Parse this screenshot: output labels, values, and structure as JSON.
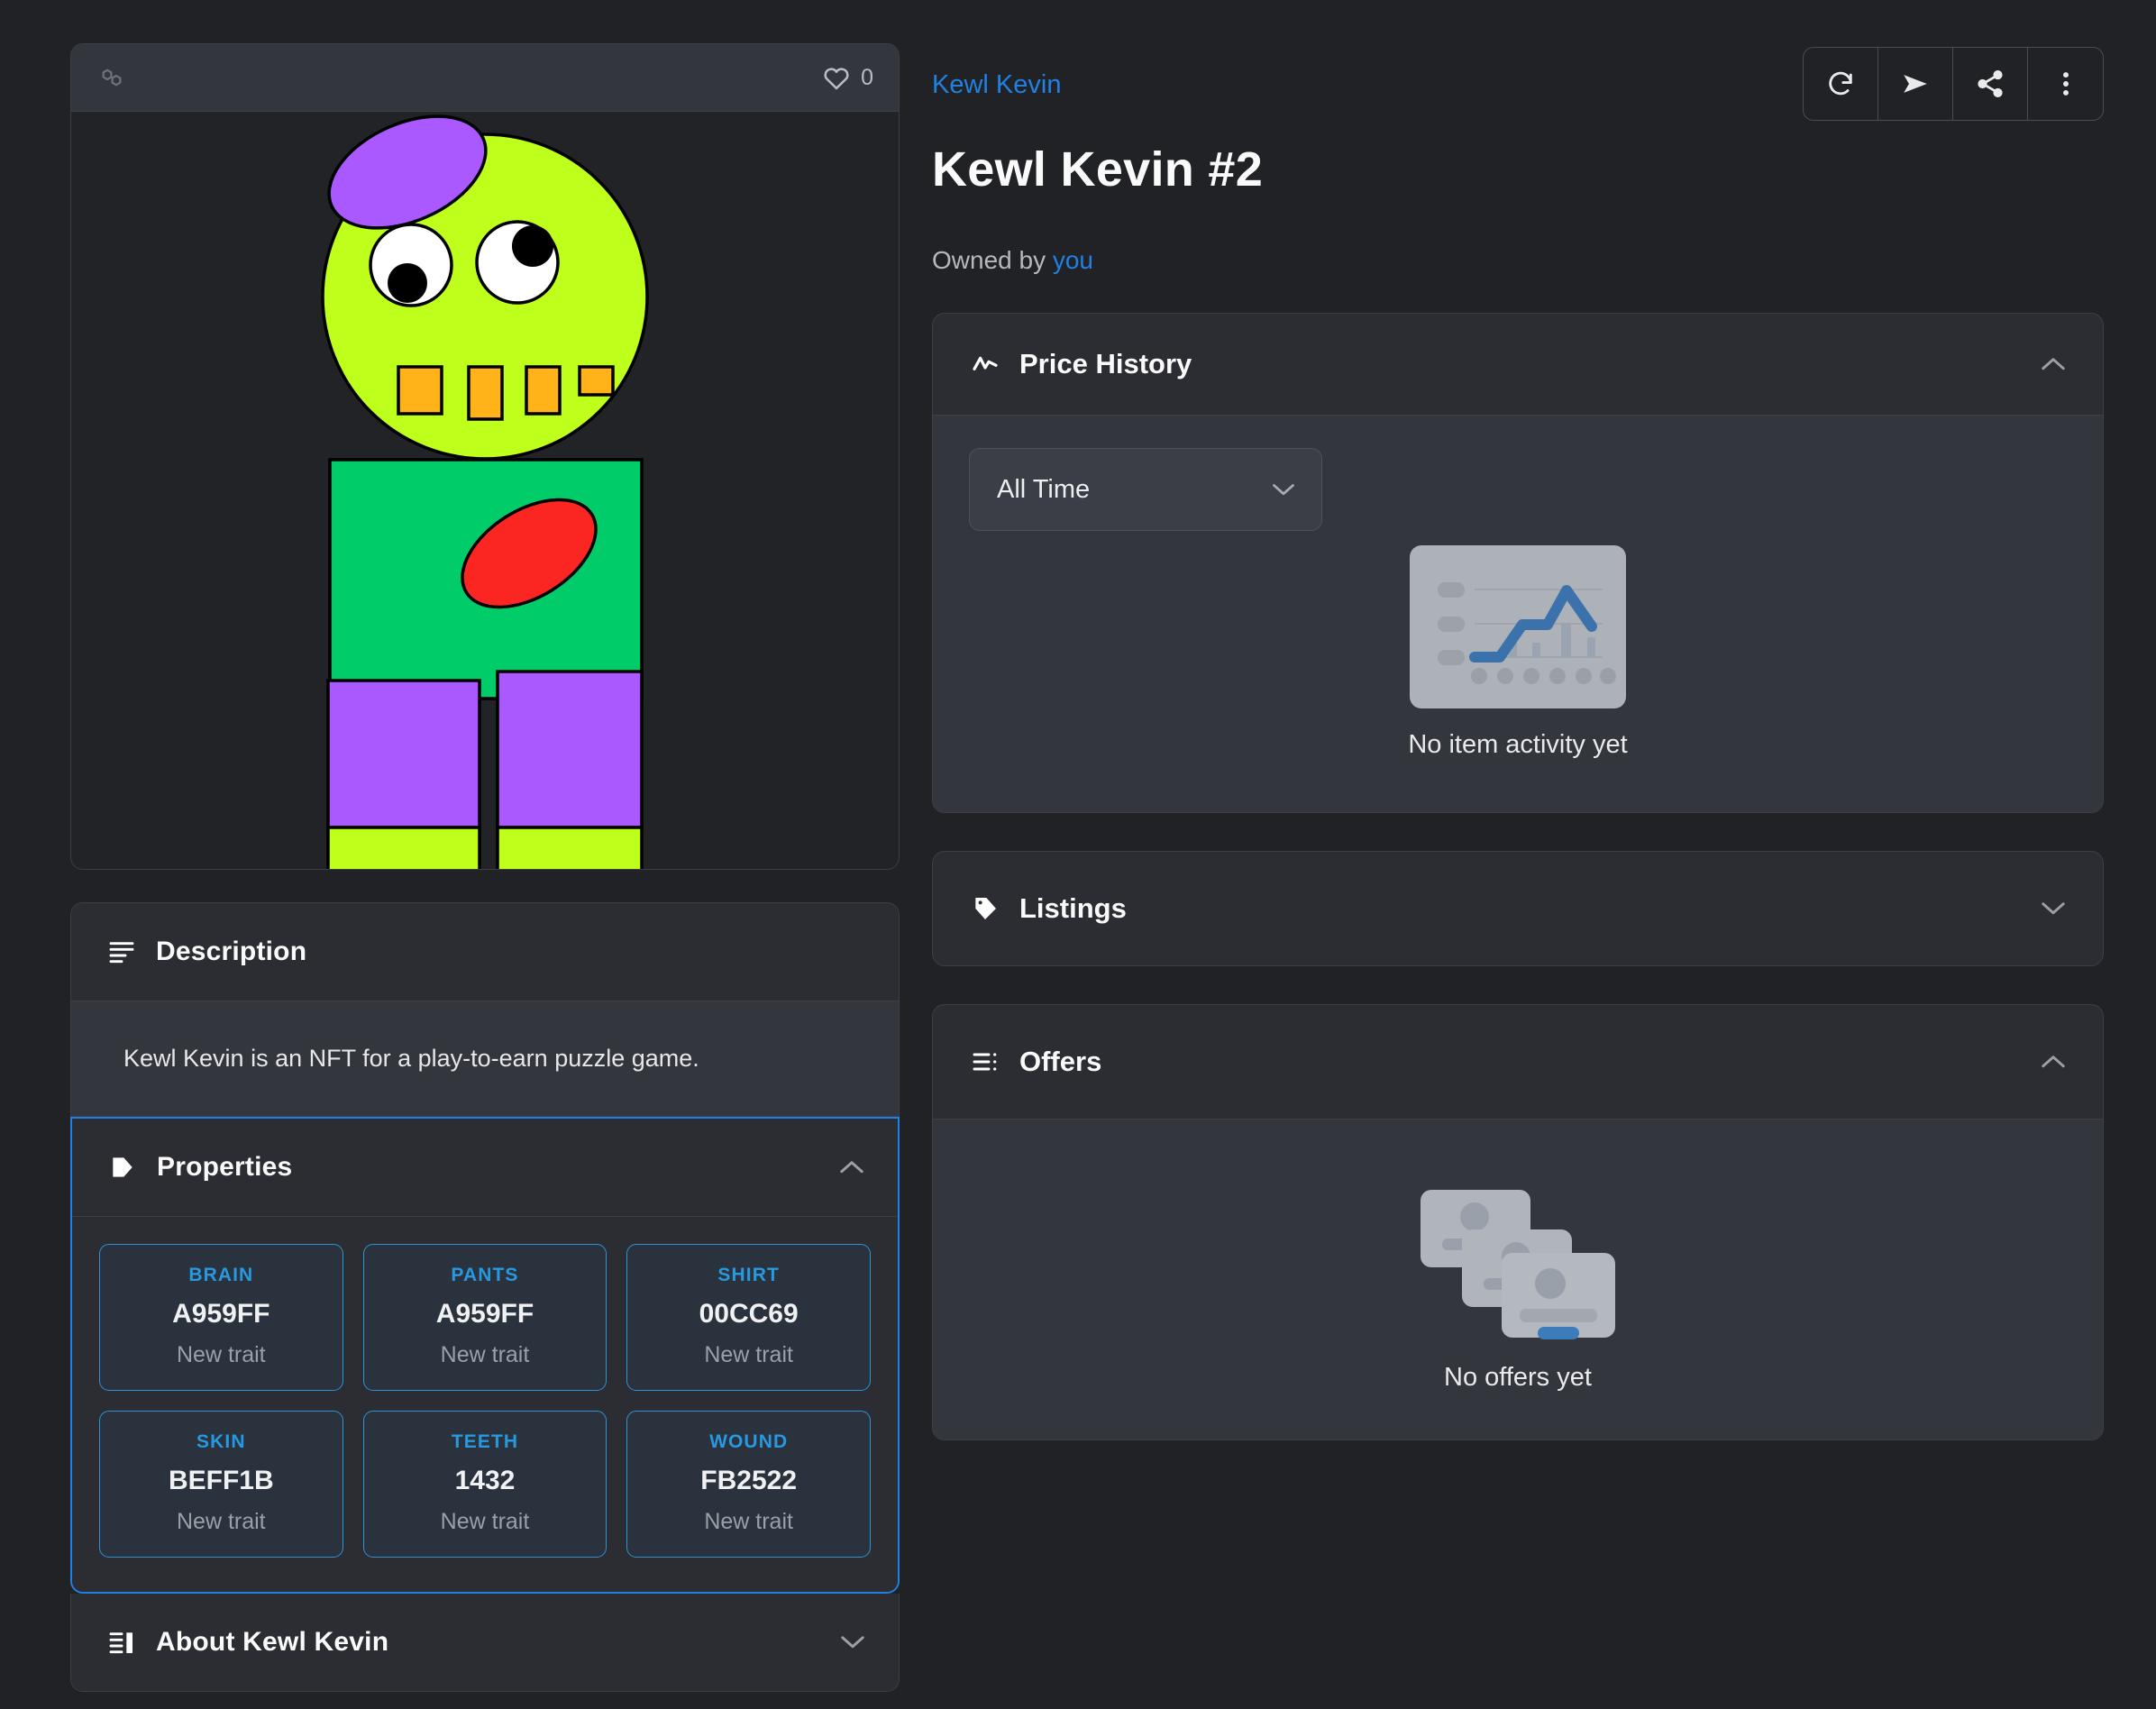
{
  "media": {
    "chain_icon": "polygon-icon",
    "like_icon": "heart-icon",
    "like_count": "0"
  },
  "header": {
    "collection_link": "Kewl Kevin",
    "title": "Kewl Kevin #2",
    "owned_prefix": "Owned by ",
    "owner": "you",
    "actions": [
      {
        "name": "refresh-metadata-button",
        "icon": "refresh-icon"
      },
      {
        "name": "transfer-button",
        "icon": "send-icon"
      },
      {
        "name": "share-button",
        "icon": "share-icon"
      },
      {
        "name": "more-options-button",
        "icon": "kebab-menu-icon"
      }
    ]
  },
  "left_panels": {
    "description": {
      "icon": "description-lines-icon",
      "title": "Description",
      "text": "Kewl Kevin is an NFT for a play-to-earn puzzle game."
    },
    "properties": {
      "icon": "tag-icon",
      "title": "Properties",
      "chevron": "chevron-up-icon",
      "traits": [
        {
          "type": "BRAIN",
          "value": "A959FF",
          "rarity": "New trait"
        },
        {
          "type": "PANTS",
          "value": "A959FF",
          "rarity": "New trait"
        },
        {
          "type": "SHIRT",
          "value": "00CC69",
          "rarity": "New trait"
        },
        {
          "type": "SKIN",
          "value": "BEFF1B",
          "rarity": "New trait"
        },
        {
          "type": "TEETH",
          "value": "1432",
          "rarity": "New trait"
        },
        {
          "type": "WOUND",
          "value": "FB2522",
          "rarity": "New trait"
        }
      ]
    },
    "about": {
      "icon": "about-book-icon",
      "title": "About Kewl Kevin",
      "chevron": "chevron-down-icon"
    }
  },
  "right_panels": {
    "price_history": {
      "icon": "activity-line-icon",
      "title": "Price History",
      "chevron": "chevron-up-icon",
      "range_select": {
        "value": "All Time",
        "chevron": "chevron-down-icon"
      },
      "empty_state": {
        "illustration": "chart-placeholder-illustration",
        "text": "No item activity yet"
      }
    },
    "listings": {
      "icon": "tag-icon",
      "title": "Listings",
      "chevron": "chevron-down-icon"
    },
    "offers": {
      "icon": "list-icon",
      "title": "Offers",
      "chevron": "chevron-up-icon",
      "empty_state": {
        "illustration": "offer-cards-illustration",
        "text": "No offers yet"
      }
    }
  },
  "artwork": {
    "name": "kewl-kevin-nft-artwork",
    "colors": {
      "skin": "#BEFF1B",
      "brain": "#A959FF",
      "shirt": "#00CC69",
      "pants": "#A959FF",
      "teeth": "#FFB319",
      "wound": "#FB2522",
      "eye_white": "#FFFFFF",
      "pupil": "#000000",
      "outline": "#000000"
    }
  },
  "theme": {
    "accent": "#2081e2",
    "page_bg": "#202225",
    "card_bg": "#2b2d33",
    "card_alt_bg": "#33363d",
    "border": "#3c3f46"
  }
}
